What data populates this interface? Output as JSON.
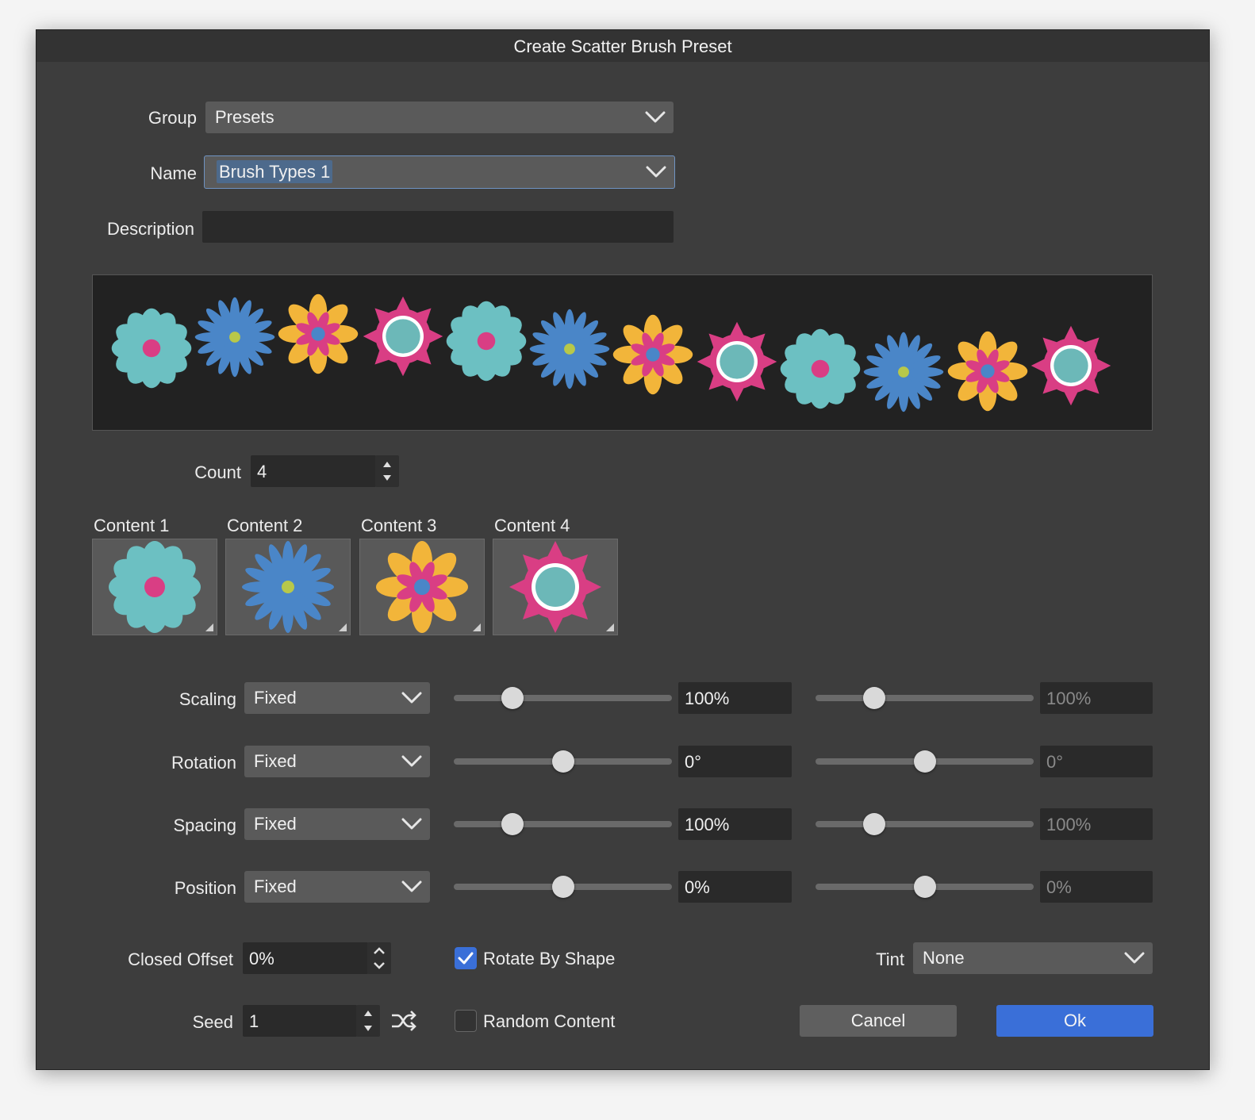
{
  "dialog": {
    "title": "Create Scatter Brush Preset"
  },
  "group": {
    "label": "Group",
    "value": "Presets"
  },
  "name": {
    "label": "Name",
    "value": "Brush Types 1"
  },
  "description": {
    "label": "Description",
    "value": ""
  },
  "count": {
    "label": "Count",
    "value": "4"
  },
  "contents": [
    {
      "label": "Content 1"
    },
    {
      "label": "Content 2"
    },
    {
      "label": "Content 3"
    },
    {
      "label": "Content 4"
    }
  ],
  "rows": [
    {
      "label": "Scaling",
      "mode": "Fixed",
      "value1": "100%",
      "value2": "100%",
      "slider1": 0.27,
      "slider2": 0.27
    },
    {
      "label": "Rotation",
      "mode": "Fixed",
      "value1": "0°",
      "value2": "0°",
      "slider1": 0.5,
      "slider2": 0.5
    },
    {
      "label": "Spacing",
      "mode": "Fixed",
      "value1": "100%",
      "value2": "100%",
      "slider1": 0.27,
      "slider2": 0.27
    },
    {
      "label": "Position",
      "mode": "Fixed",
      "value1": "0%",
      "value2": "0%",
      "slider1": 0.5,
      "slider2": 0.5
    }
  ],
  "closed_offset": {
    "label": "Closed Offset",
    "value": "0%"
  },
  "rotate_by_shape": {
    "label": "Rotate By Shape",
    "checked": true
  },
  "tint": {
    "label": "Tint",
    "value": "None"
  },
  "seed": {
    "label": "Seed",
    "value": "1"
  },
  "random_content": {
    "label": "Random Content",
    "checked": false
  },
  "buttons": {
    "cancel": "Cancel",
    "ok": "Ok"
  },
  "colors": {
    "accent": "#3a6fd8",
    "teal": "#6cc0c2",
    "blue": "#4a86c8",
    "yellow": "#f2b53a",
    "pink": "#d93e84"
  }
}
